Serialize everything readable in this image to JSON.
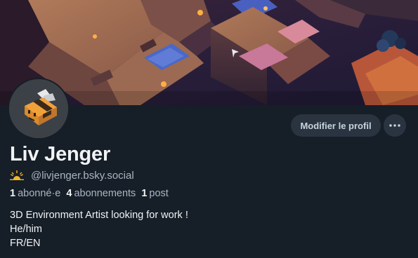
{
  "profile": {
    "display_name": "Liv Jenger",
    "handle": "@livjenger.bsky.social",
    "handle_prefix_icon": "sunrise-emoji-icon",
    "avatar_icon": "bee-avatar-icon",
    "stats": {
      "followers_count": "1",
      "followers_label": "abonné·e",
      "following_count": "4",
      "following_label": "abonnements",
      "posts_count": "1",
      "posts_label": "post"
    },
    "bio_lines": [
      "3D Environment Artist looking for work !",
      "He/him",
      "FR/EN"
    ]
  },
  "actions": {
    "edit_profile_label": "Modifier le profil",
    "more_icon": "ellipsis-icon"
  },
  "colors": {
    "background": "#161e27",
    "button_background": "#2a3441",
    "muted_text": "#aab6c3",
    "primary_text": "#f1f3f5"
  }
}
